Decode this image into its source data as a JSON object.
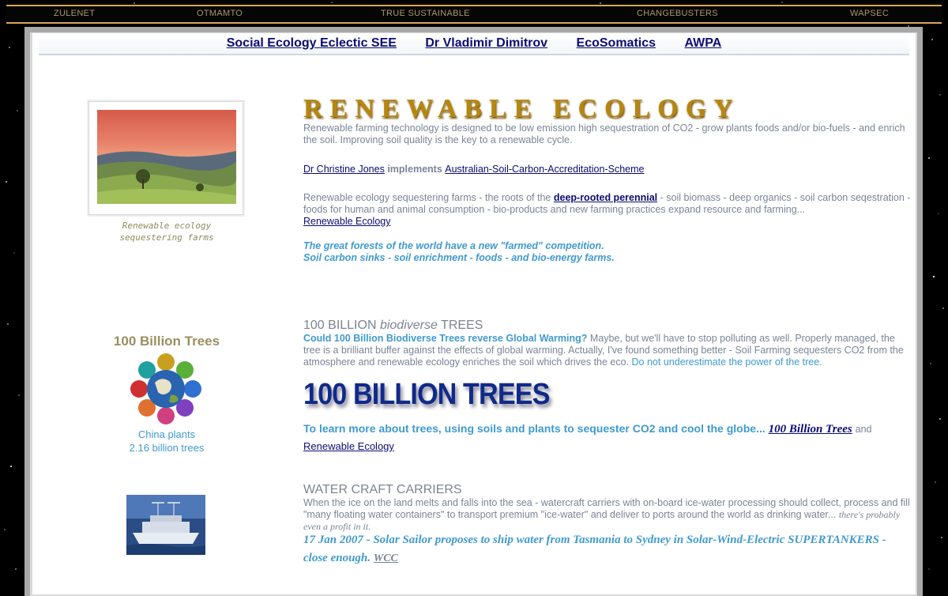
{
  "top_nav": [
    "ZULENET",
    "OTMAMTO",
    "TRUE SUSTAINABLE",
    "CHANGEBUSTERS",
    "WAPSEC"
  ],
  "nav_links": [
    "Social Ecology Eclectic SEE",
    "Dr Vladimir Dimitrov",
    "EcoSomatics",
    "AWPA"
  ],
  "sidebar": {
    "photo_caption_1": "Renewable ecology",
    "photo_caption_2": "sequestering farms",
    "trees_title": "100 Billion Trees",
    "china_line_1": "China plants",
    "china_line_2": "2.16 billion trees"
  },
  "renewable": {
    "title": "RENEWABLE ECOLOGY",
    "intro": "Renewable farming technology is designed to be low emission high sequestration of CO2 - grow plants foods and/or bio-fuels - and enrich the soil. Improving soil quality is the key to a renewable cycle.",
    "jones_link": "Dr Christine Jones",
    "implements": "implements",
    "scheme_link": "Australian-Soil-Carbon-Accreditation-Scheme",
    "farms_text_a": "Renewable ecology sequestering farms - the roots of the",
    "perennial_link": "deep-rooted perennial",
    "farms_text_b": "- soil biomass - deep organics - soil carbon seqestration - foods for human and animal consumption - bio-products and new farming practices expand resource and farming...",
    "renewable_link": "Renewable Ecology",
    "forests_1": "The great forests of the world have a new \"farmed\" competition.",
    "forests_2": "Soil carbon sinks - soil enrichment - foods - and bio-energy farms."
  },
  "trees": {
    "heading_a": "100 BILLION",
    "heading_b": "biodiverse",
    "heading_c": "TREES",
    "question": "Could 100 Billion Biodiverse Trees reverse Global Warming?",
    "body": "Maybe, but we'll have to stop polluting as well. Properly managed, the tree is a brilliant buffer against the effects of global warming. Actually, I've found something better - Soil Farming sequesters CO2 from the atmosphere and renewable ecology enriches the soil which drives the eco.",
    "underestimate": "Do not underestimate the power of the tree.",
    "banner": "100 BILLION TREES",
    "learn": "To learn more about trees, using soils and plants to sequester CO2 and cool the globe...",
    "learn_link": "100 Billion Trees",
    "and": "and",
    "renewable_link": "Renewable Ecology"
  },
  "water": {
    "heading": "WATER CRAFT CARRIERS",
    "body": "When the ice on the land melts and falls into the sea - watercraft carriers with on-board ice-water processing should collect, process and fill \"many floating water containers\" to transport premium \"ice-water\" and deliver to ports around the world as drinking water...",
    "profit": "there's probably even a profit in it.",
    "news": "17 Jan 2007 - Solar Sailor proposes to ship water from Tasmania to Sydney in Solar-Wind-Electric SUPERTANKERS - close enough.",
    "wcc_link": "WCC"
  }
}
